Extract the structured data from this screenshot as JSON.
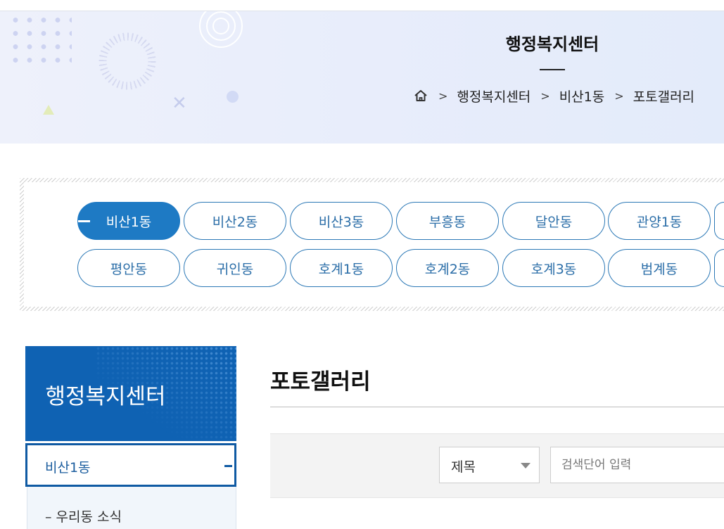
{
  "header": {
    "title": "행정복지센터",
    "breadcrumb": [
      "행정복지센터",
      "비산1동",
      "포토갤러리"
    ],
    "home_icon": "home-icon"
  },
  "dong_tabs": {
    "row1": [
      "비산1동",
      "비산2동",
      "비산3동",
      "부흥동",
      "달안동",
      "관양1동"
    ],
    "row2": [
      "평안동",
      "귀인동",
      "호계1동",
      "호계2동",
      "호계3동",
      "범계동"
    ],
    "active": "비산1동",
    "accent_color": "#1e7ac4"
  },
  "sidebar": {
    "title": "행정복지센터",
    "active_item": "비산1동",
    "sub_items": [
      "– 우리동 소식"
    ],
    "header_color": "#0f62b3"
  },
  "main": {
    "title": "포토갤러리",
    "search": {
      "select_value": "제목",
      "placeholder": "검색단어 입력"
    }
  }
}
